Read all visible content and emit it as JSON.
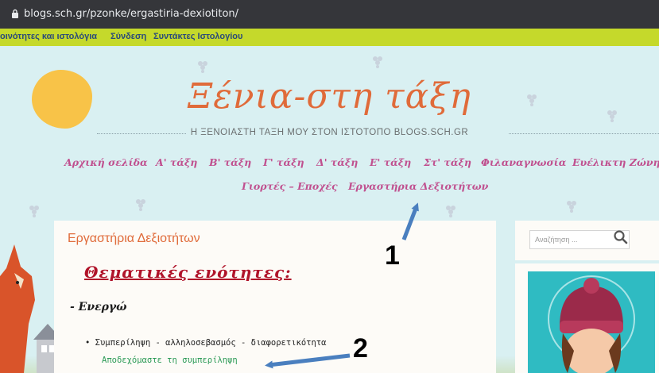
{
  "browser": {
    "url": "blogs.sch.gr/pzonke/ergastiria-dexiotiton/"
  },
  "blog_bar": {
    "items": [
      "οινότητες και ιστολόγια",
      "Σύνδεση",
      "Συντάκτες Ιστολογίου"
    ]
  },
  "site": {
    "title": "Ξένια-στη τάξη",
    "tagline": "Η ΞΕΝΟΙΑΣΤΗ ΤΑΞΗ ΜΟΥ ΣΤΟΝ ΙΣΤΟΤΟΠΟ BLOGS.SCH.GR"
  },
  "nav": {
    "row1": [
      "Αρχική σελίδα",
      "Α' τάξη",
      "Β' τάξη",
      "Γ' τάξη",
      "Δ' τάξη",
      "Ε' τάξη",
      "Στ' τάξη",
      "Φιλαναγνωσία",
      "Ευέλικτη Ζώνη"
    ],
    "row2": [
      "Γιορτές – Εποχές",
      "Εργαστήρια Δεξιοτήτων"
    ]
  },
  "post": {
    "title": "Εργαστήρια Δεξιοτήτων",
    "section_title": "Θεματικές ενότητες:",
    "subhead": "- Ενεργώ",
    "bullet": "Συμπερίληψη - αλληλοσεβασμός - διαφορετικότητα",
    "link": "Αποδεχόμαστε τη συμπερίληψη"
  },
  "search": {
    "placeholder": "Αναζήτηση ...",
    "icon": "search-icon"
  },
  "annotations": {
    "label1": "1",
    "label2": "2"
  },
  "colors": {
    "accent_orange": "#e06b3a",
    "nav_pink": "#c0508f",
    "blog_bar": "#c5d92b",
    "link_green": "#2b9a56",
    "arrow_blue": "#4a7fbf"
  }
}
